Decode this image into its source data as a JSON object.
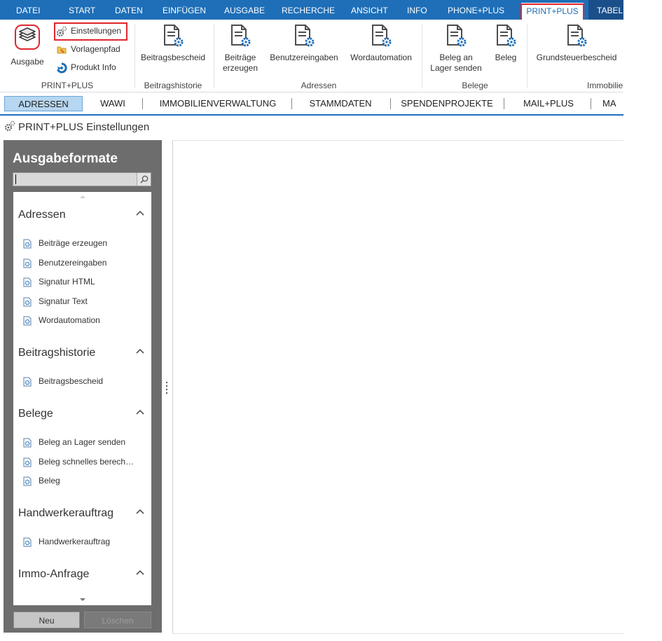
{
  "menubar": {
    "tabs": [
      {
        "label": "DATEI"
      },
      {
        "label": "START"
      },
      {
        "label": "DATEN"
      },
      {
        "label": "EINFÜGEN"
      },
      {
        "label": "AUSGABE"
      },
      {
        "label": "RECHERCHE"
      },
      {
        "label": "ANSICHT"
      },
      {
        "label": "INFO"
      },
      {
        "label": "PHONE+PLUS"
      },
      {
        "label": "PRINT+PLUS"
      },
      {
        "label": "TABELL"
      }
    ],
    "active_tab": "PRINT+PLUS"
  },
  "ribbon": {
    "ausgabe": "Ausgabe",
    "einstellungen": "Einstellungen",
    "vorlagenpfad": "Vorlagenpfad",
    "produkt_info": "Produkt Info",
    "beitragsbescheid": "Beitragsbescheid",
    "beitraege_line1": "Beiträge",
    "beitraege_line2": "erzeugen",
    "benutzereingaben": "Benutzereingaben",
    "wordautomation": "Wordautomation",
    "beleg_lager_line1": "Beleg an",
    "beleg_lager_line2": "Lager senden",
    "beleg": "Beleg",
    "grundsteuerbescheid": "Grundsteuerbescheid",
    "groups": {
      "printplus": "PRINT+PLUS",
      "beitragshistorie": "Beitragshistorie",
      "adressen": "Adressen",
      "belege": "Belege",
      "immobilien": "Immobilie"
    }
  },
  "modules": {
    "tabs": [
      {
        "label": "ADRESSEN"
      },
      {
        "label": "WAWI"
      },
      {
        "label": "IMMOBILIENVERWALTUNG"
      },
      {
        "label": "STAMMDATEN"
      },
      {
        "label": "SPENDENPROJEKTE"
      },
      {
        "label": "MAIL+PLUS"
      },
      {
        "label": "MA"
      }
    ],
    "active": "ADRESSEN"
  },
  "page": {
    "title": "PRINT+PLUS Einstellungen"
  },
  "panel": {
    "title": "Ausgabeformate",
    "search_value": "",
    "sections": [
      {
        "title": "Adressen",
        "items": [
          "Beiträge erzeugen",
          "Benutzereingaben",
          "Signatur HTML",
          "Signatur Text",
          "Wordautomation"
        ]
      },
      {
        "title": "Beitragshistorie",
        "items": [
          "Beitragsbescheid"
        ]
      },
      {
        "title": "Belege",
        "items": [
          "Beleg an Lager senden",
          "Beleg schnelles berech…",
          "Beleg"
        ]
      },
      {
        "title": "Handwerkerauftrag",
        "items": [
          "Handwerkerauftrag"
        ]
      },
      {
        "title": "Immo-Anfrage",
        "items": []
      }
    ],
    "buttons": {
      "neu": "Neu",
      "loeschen": "Löschen"
    }
  },
  "colors": {
    "ribbon_blue": "#1e6fb8",
    "highlight_red": "#e0262f",
    "panel_gray": "#6d6d6d",
    "active_module": "#b7d6f1"
  },
  "icons": {
    "ausgabe": "stacked-layers-icon",
    "einstellungen": "gears-icon",
    "vorlagenpfad": "folder-icon",
    "produkt_info": "info-refresh-icon",
    "document_gear": "document-gear-icon",
    "search": "search-icon",
    "chevron": "chevron-up-icon",
    "list_item": "small-document-gear-icon"
  }
}
